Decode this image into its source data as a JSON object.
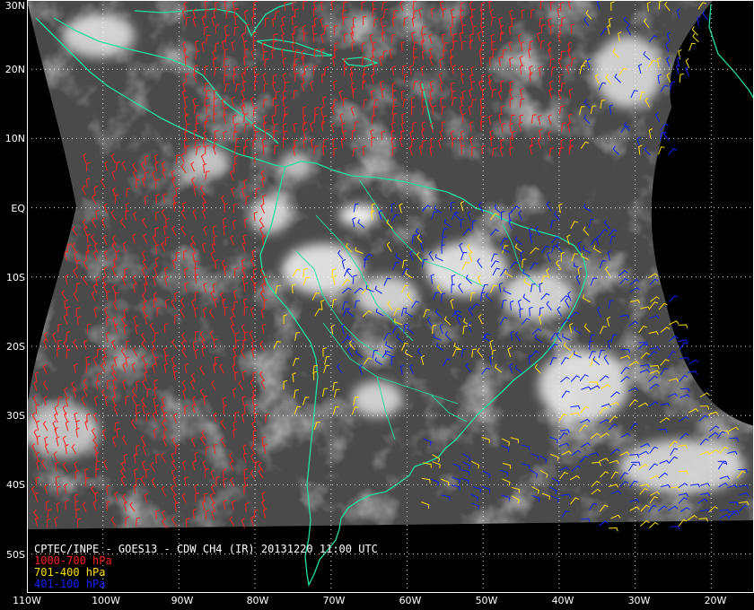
{
  "title": "CPTEC/INPE - GOES13 - CDW CH4 (IR) 20131220 11:00 UTC",
  "legend": [
    {
      "label": "1000-700 hPa",
      "color": "#ff2020"
    },
    {
      "label": "701-400 hPa",
      "color": "#ffe000"
    },
    {
      "label": "401-100 hPa",
      "color": "#1020ff"
    }
  ],
  "lat_labels": [
    "30N",
    "20N",
    "10N",
    "EQ",
    "10S",
    "20S",
    "30S",
    "40S",
    "50S"
  ],
  "lat_values": [
    30,
    20,
    10,
    0,
    -10,
    -20,
    -30,
    -40,
    -50
  ],
  "lon_labels": [
    "110W",
    "100W",
    "90W",
    "80W",
    "70W",
    "60W",
    "50W",
    "40W",
    "30W",
    "20W"
  ],
  "lon_values": [
    -110,
    -100,
    -90,
    -80,
    -70,
    -60,
    -50,
    -40,
    -30,
    -20
  ],
  "coast_color": "#20e0a0",
  "grid_color": "#ffffff"
}
